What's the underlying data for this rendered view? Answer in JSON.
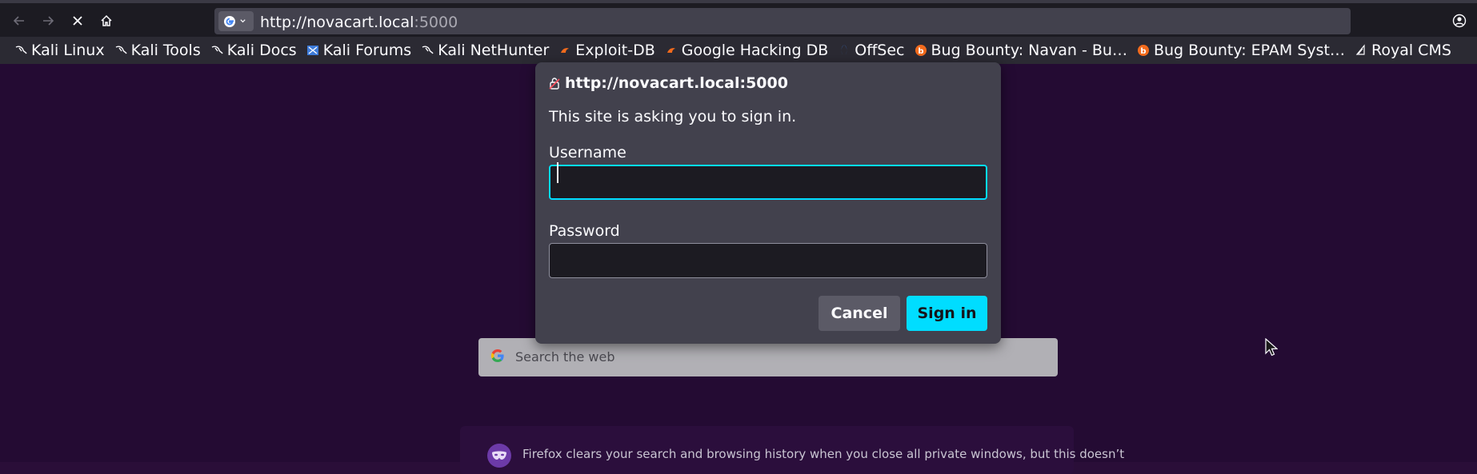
{
  "browser": {
    "url_host": "http://novacart.local",
    "url_port": ":5000",
    "icons": {
      "back": "arrow-left-icon",
      "forward": "arrow-right-icon",
      "stop": "close-icon",
      "home": "home-icon",
      "engine": "google-icon",
      "account": "account-icon"
    }
  },
  "bookmarks": [
    {
      "label": "Kali Linux",
      "icon": "kali-icon"
    },
    {
      "label": "Kali Tools",
      "icon": "kali-icon"
    },
    {
      "label": "Kali Docs",
      "icon": "kali-icon"
    },
    {
      "label": "Kali Forums",
      "icon": "kali-forums-icon"
    },
    {
      "label": "Kali NetHunter",
      "icon": "kali-icon"
    },
    {
      "label": "Exploit-DB",
      "icon": "exploitdb-icon"
    },
    {
      "label": "Google Hacking DB",
      "icon": "exploitdb-icon"
    },
    {
      "label": "OffSec",
      "icon": "offsec-icon"
    },
    {
      "label": "Bug Bounty: Navan - Bu…",
      "icon": "bugcrowd-icon"
    },
    {
      "label": "Bug Bounty: EPAM Syst…",
      "icon": "bugcrowd-icon"
    },
    {
      "label": "Royal CMS",
      "icon": "royal-icon"
    }
  ],
  "dialog": {
    "host": "http://novacart.local:5000",
    "message": "This site is asking you to sign in.",
    "username_label": "Username",
    "username_value": "",
    "password_label": "Password",
    "password_value": "",
    "cancel_label": "Cancel",
    "signin_label": "Sign in"
  },
  "page": {
    "search_placeholder": "Search the web",
    "private_notice": "Firefox clears your search and browsing history when you close all private windows, but this doesn’t"
  },
  "colors": {
    "accent": "#00ddff",
    "page_bg": "#240b33",
    "dialog_bg": "#42414d"
  }
}
